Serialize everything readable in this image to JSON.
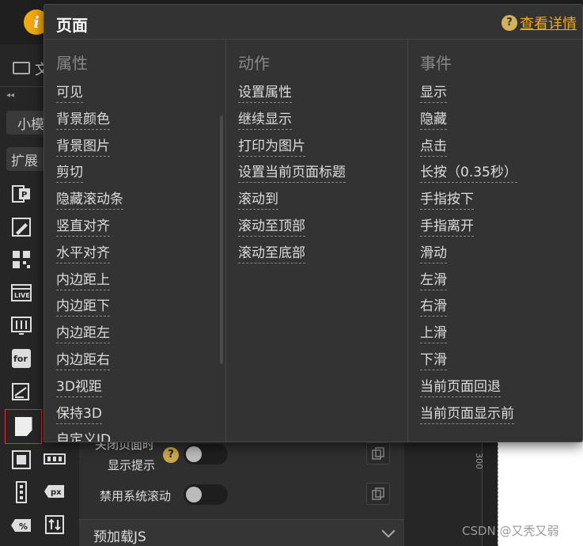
{
  "app": {
    "logo_glyph": "i",
    "file_label": "文",
    "pill1": "小",
    "pill1_more": "模",
    "pill2": "扩展",
    "ruler_number": "300",
    "watermark": "CSDN @又秃又弱",
    "icons": [
      "ppt-icon",
      "pen-icon",
      "qr-code-icon",
      "live-icon",
      "equalizer-icon",
      "for-loop-icon",
      "edit-icon",
      "page-icon",
      "layer-icon",
      "layout-bar-icon",
      "vertical-dots-icon",
      "px-icon",
      "percent-icon",
      "sort-icon"
    ],
    "for_label": "for",
    "live_label": "LIVE",
    "px_label": "px",
    "percent_label": "%"
  },
  "settings": {
    "close_label_line1": "关闭页面时",
    "close_label_line2": "显示提示",
    "disable_scroll_label": "禁用系统滚动",
    "preload_label": "预加载JS",
    "help_glyph": "?"
  },
  "popup": {
    "title": "页面",
    "help_glyph": "?",
    "detail_link": "查看详情",
    "columns": [
      {
        "header": "属性",
        "items": [
          "可见",
          "背景颜色",
          "背景图片",
          "剪切",
          "隐藏滚动条",
          "竖直对齐",
          "水平对齐",
          "内边距上",
          "内边距下",
          "内边距左",
          "内边距右",
          "3D视距",
          "保持3D",
          "自定义ID"
        ]
      },
      {
        "header": "动作",
        "items": [
          "设置属性",
          "继续显示",
          "打印为图片",
          "设置当前页面标题",
          "滚动到",
          "滚动至顶部",
          "滚动至底部"
        ]
      },
      {
        "header": "事件",
        "items": [
          "显示",
          "隐藏",
          "点击",
          "长按（0.35秒）",
          "手指按下",
          "手指离开",
          "滑动",
          "左滑",
          "右滑",
          "上滑",
          "下滑",
          "当前页面回退",
          "当前页面显示前"
        ]
      }
    ]
  }
}
